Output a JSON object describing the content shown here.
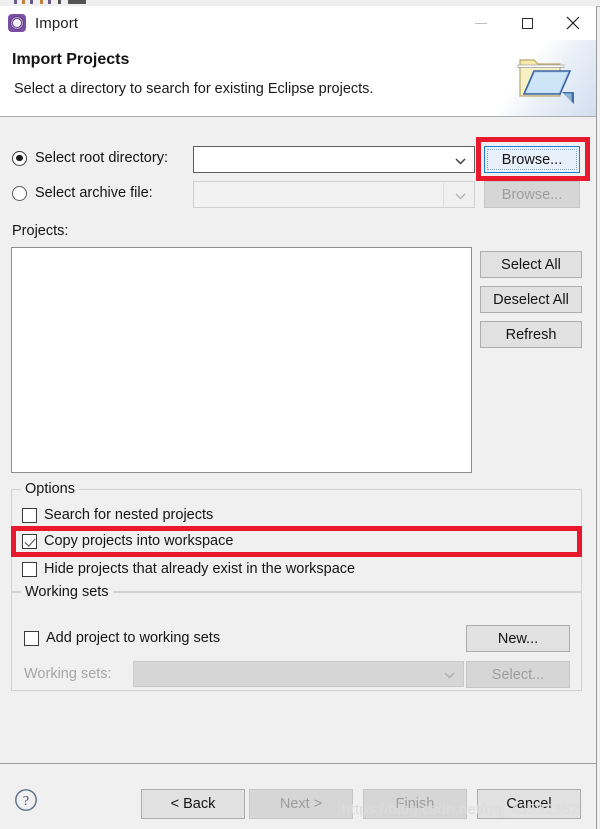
{
  "window": {
    "title": "Import",
    "icon": "eclipse-import-icon",
    "controls": {
      "minimize": "minimize-icon",
      "maximize": "maximize-icon",
      "close": "close-icon"
    }
  },
  "banner": {
    "title": "Import Projects",
    "subtitle": "Select a directory to search for existing Eclipse projects.",
    "icon": "open-folder-icon"
  },
  "source": {
    "root_directory": {
      "label": "Select root directory:",
      "selected": true,
      "value": "",
      "placeholder": ""
    },
    "archive_file": {
      "label": "Select archive file:",
      "selected": false,
      "value": "",
      "placeholder": "",
      "enabled": false
    },
    "browse_root_label": "Browse...",
    "browse_archive_label": "Browse..."
  },
  "projects": {
    "label": "Projects:",
    "items": [],
    "select_all_label": "Select All",
    "deselect_all_label": "Deselect All",
    "refresh_label": "Refresh"
  },
  "options": {
    "group_title": "Options",
    "checkboxes": [
      {
        "label": "Search for nested projects",
        "checked": false
      },
      {
        "label": "Copy projects into workspace",
        "checked": true
      },
      {
        "label": "Hide projects that already exist in the workspace",
        "checked": false
      }
    ]
  },
  "working_sets": {
    "group_title": "Working sets",
    "add_checkbox": {
      "label": "Add project to working sets",
      "checked": false
    },
    "new_label": "New...",
    "sets_label": "Working sets:",
    "sets_value": "",
    "select_label": "Select...",
    "enabled": false
  },
  "footer": {
    "help": "help-icon",
    "back_label": "< Back",
    "next_label": "Next >",
    "finish_label": "Finish",
    "cancel_label": "Cancel",
    "back_enabled": true,
    "next_enabled": false,
    "finish_enabled": false,
    "cancel_enabled": true
  },
  "annotations": {
    "highlight_color": "#e8192c",
    "regions": [
      "browse-root-button",
      "copy-projects-into-workspace-checkbox"
    ]
  },
  "watermark": {
    "text": "https://blog.csdn.net/qq_43592352"
  },
  "colors": {
    "dialog_background": "#f0f0f0",
    "banner_background": "#ffffff",
    "accent_focus": "#1a7fd4",
    "annotation_red": "#e8192c",
    "title_icon_purple": "#7b4fa3"
  }
}
